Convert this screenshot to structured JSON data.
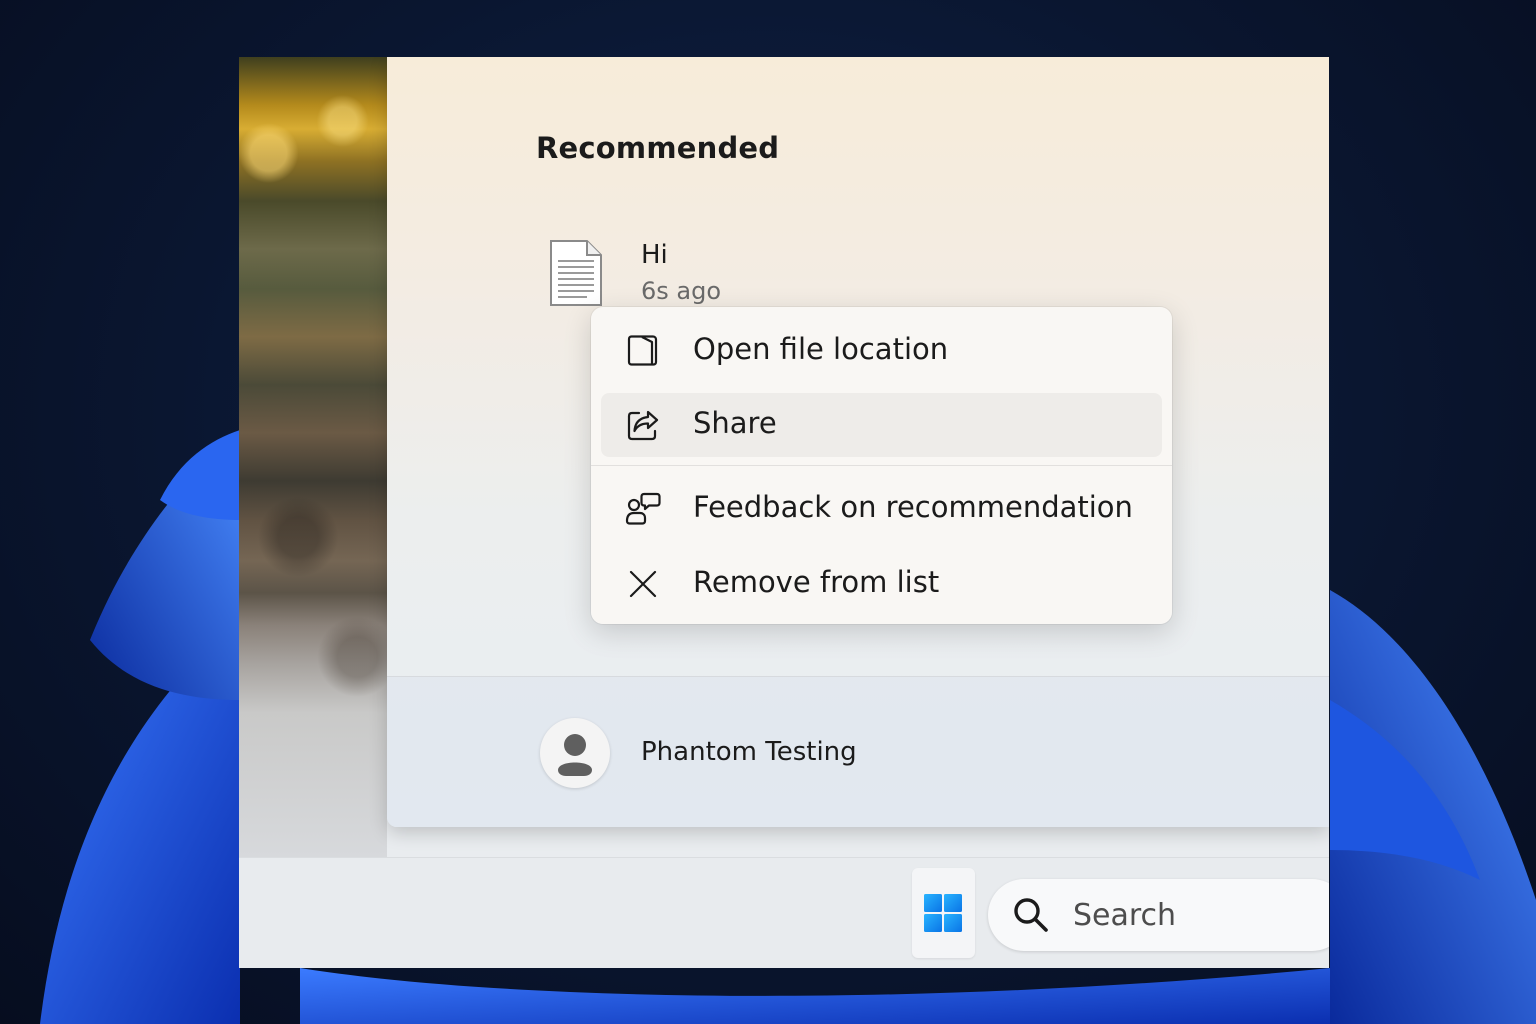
{
  "recommended": {
    "title": "Recommended",
    "file": {
      "name": "Hi",
      "time": "6s ago",
      "icon": "document-icon"
    }
  },
  "context_menu": {
    "items": [
      {
        "label": "Open file location",
        "icon": "folder-open-icon"
      },
      {
        "label": "Share",
        "icon": "share-icon",
        "hovered": true
      },
      {
        "label": "Feedback on recommendation",
        "icon": "feedback-icon"
      },
      {
        "label": "Remove from list",
        "icon": "close-icon"
      }
    ]
  },
  "user": {
    "name": "Phantom Testing",
    "icon": "avatar-icon"
  },
  "taskbar": {
    "start_icon": "windows-logo-icon",
    "search_placeholder": "Search",
    "search_icon": "search-icon"
  },
  "colors": {
    "windows_blue": "#1e90ff",
    "wallpaper_bloom": "#1f4ed8",
    "backdrop": "#0a1630"
  }
}
